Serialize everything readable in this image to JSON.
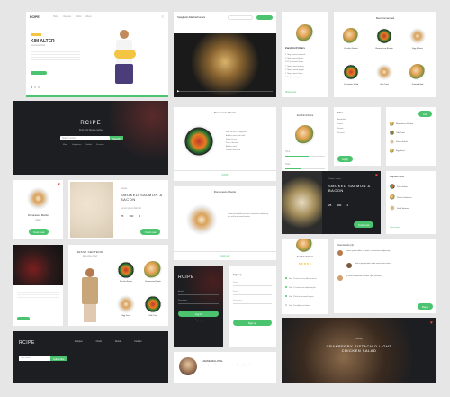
{
  "brand": "RCIPE",
  "hero": {
    "badge": "",
    "name": "KIM ALTER",
    "role": "Executive Chef",
    "nav": [
      "Home",
      "Recipes",
      "Chefs",
      "About"
    ]
  },
  "video": {
    "title": "Spaghetti Alla Carbonara"
  },
  "recipe_lists": {
    "dish": "Zucchini Fritters",
    "ingredients": [
      "1 Tbsp Ground cinnamon",
      "2 Tbsp Ground allspice",
      "1/2 Tsp Ground Ginger",
      "1 Tbsp Ground nutmeg",
      "1 Tbsp Grounds pepper",
      "1 Tbsp Ground cloves",
      "2 Tbsp Fresh thyme leaves"
    ],
    "more": "Show more"
  },
  "recommended": {
    "title": "Recommended",
    "items": [
      "Zucchini Fritters",
      "Romanesco Risotto",
      "Egg & Toast",
      "Cucumber Salad",
      "Vide Tuna",
      "Potato Salad"
    ]
  },
  "search": {
    "tagline": "Find your favorite recipe",
    "placeholder": "Search recipes",
    "button": "Search",
    "tags": [
      "Meat",
      "Vegetarian",
      "Salads",
      "Desserts"
    ]
  },
  "tomato": {
    "title": "Romanesco Risotto",
    "steps": [
      "Heat the oil in a large pan",
      "Add the onion and cook",
      "Stir in the rice",
      "Pour in the wine",
      "Add the stock",
      "Season and serve"
    ],
    "cta": "COOK"
  },
  "slider": {
    "title": "Zucchini Fritters",
    "label_time": "Time",
    "label_heat": "Heat",
    "unit": "min"
  },
  "filter": {
    "title": "Filter",
    "options": [
      "Breakfast",
      "Lunch",
      "Dinner",
      "Dessert"
    ],
    "button": "Apply"
  },
  "cook_list": {
    "items": [
      "Romanesco Risotto",
      "Vide Tuna",
      "Potato Salad",
      "Egg Toast"
    ],
    "cta": "Add"
  },
  "dark_recipe": {
    "label": "Today's recipe",
    "title": "SMOKED SALMON & BACON",
    "stats": [
      "25",
      "300",
      "4"
    ],
    "stat_labels": [
      "min",
      "kcal",
      "serv"
    ],
    "cta": "Cook now"
  },
  "popular": {
    "title": "Popular Now",
    "items": [
      "Pizza Italian",
      "Pasta Carbonara",
      "Fried Salmon"
    ],
    "more": "Show more"
  },
  "risotto_card": {
    "title": "Romanesco Risotto",
    "sub": "Italian",
    "cta": "Cook now"
  },
  "salmon": {
    "label": "Recipe",
    "title": "SMOKED SALMON & BACON",
    "sub": "Lorem ipsum dolor sit",
    "stats": [
      "25",
      "300",
      "4"
    ],
    "cta": "Cook now"
  },
  "bowl": {
    "title": "Romanesco Risotto",
    "text": "Lorem ipsum dolor sit amet, consectetur adipiscing elit, sed do eiusmod tempor.",
    "cta": "Cook now"
  },
  "zucchini_rate": {
    "title": "Zucchini Fritters",
    "rating": "★★★★★"
  },
  "comments": {
    "title": "Comments (4)",
    "items": [
      "Lorem ipsum dolor sit amet, consectetur adipiscing.",
      "Sed ut perspiciatis unde omnis iste natus.",
      "Ut enim ad minima veniam, quis nostrum."
    ],
    "reply": "Reply"
  },
  "chef": {
    "name": "JESSY CENTENO",
    "role": "Executive Chef",
    "text": "Lorem ipsum dolor sit amet, consectetur adipiscing elit.",
    "cta": "Follow"
  },
  "grid": {
    "items": [
      "Zucchini Fritters",
      "Romanesco Risotto",
      "Egg Toast",
      "Vide Tuna"
    ]
  },
  "login": {
    "brand": "RCIPE",
    "email": "Email",
    "password": "Password",
    "button": "Log in",
    "signup": "Sign up"
  },
  "timeline": {
    "items": [
      "Step 1 Lorem ipsum dolor sit amet",
      "Step 2 Consectetur adipiscing elit",
      "Step 3 Sed do eiusmod tempor",
      "Step 4 Incididunt ut labore"
    ]
  },
  "form": {
    "title": "Sign up",
    "fields": [
      "Name",
      "Email",
      "Password"
    ],
    "button": "Sign up"
  },
  "footer": {
    "brand": "RCIPE",
    "placeholder": "Your email",
    "button": "Subscribe",
    "cols": [
      "Recipes",
      "Chefs",
      "About",
      "Contact"
    ]
  },
  "profile": {
    "name": "JAMIE MALONE",
    "text": "Lorem ipsum dolor sit amet, consectetur adipiscing elit sed do."
  },
  "cranberry": {
    "label": "Recipe",
    "title": "CRANBERRY PISTACHIO LIGHT CHICKEN SALAD"
  },
  "colors": {
    "accent": "#4cc46f",
    "dark": "#1d1e21"
  }
}
